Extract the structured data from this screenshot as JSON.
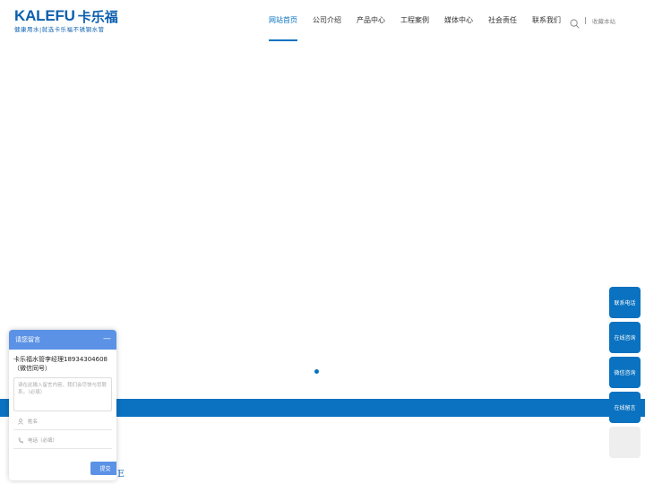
{
  "brand": {
    "logo_en": "KALEFU",
    "logo_cn": "卡乐福",
    "slogan": "健康用水|就选卡乐福不锈钢水管"
  },
  "nav": {
    "items": [
      {
        "label": "网站首页",
        "active": true
      },
      {
        "label": "公司介绍",
        "active": false
      },
      {
        "label": "产品中心",
        "active": false
      },
      {
        "label": "工程案例",
        "active": false
      },
      {
        "label": "媒体中心",
        "active": false
      },
      {
        "label": "社会责任",
        "active": false
      },
      {
        "label": "联系我们",
        "active": false
      }
    ],
    "favorite_label": "收藏本站",
    "search_icon": "search-icon"
  },
  "banner": {
    "slide_count": 1,
    "active_slide": 1
  },
  "partial_text": "E",
  "float_bar": {
    "buttons": [
      {
        "label": "联系电话"
      },
      {
        "label": "在线咨询"
      },
      {
        "label": "微信咨询"
      },
      {
        "label": "在线留言"
      },
      {
        "label": ""
      }
    ]
  },
  "message_box": {
    "title": "请您留言",
    "minimize_icon": "minus-icon",
    "intro": "卡乐福水管李经理18934304608（微信同号）",
    "textarea_placeholder": "请在此输入留言内容，我们会尽快与您联系。（必填）",
    "name_placeholder": "姓名",
    "phone_placeholder": "电话（必填）",
    "name_icon": "user-icon",
    "phone_icon": "phone-icon",
    "submit_label": "提交"
  },
  "colors": {
    "brand_blue": "#0a72c0",
    "logo_blue": "#0b5fae",
    "popup_blue": "#5b92e5"
  }
}
